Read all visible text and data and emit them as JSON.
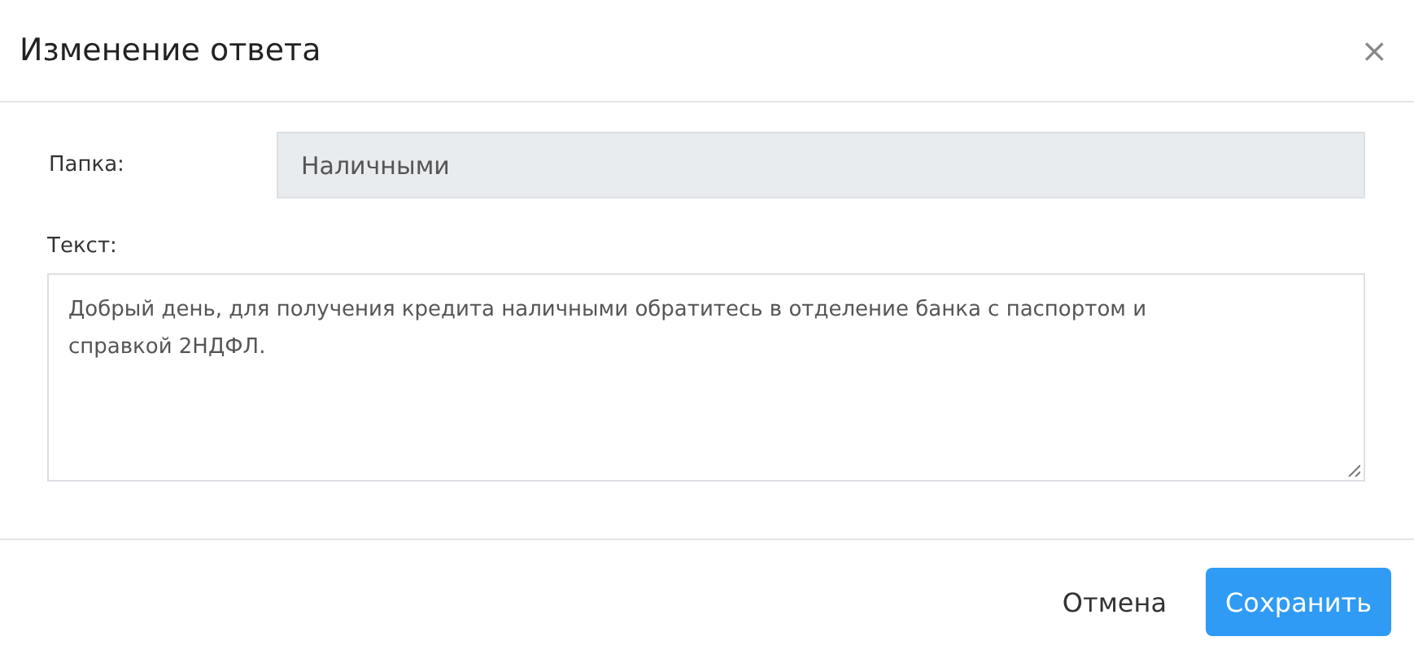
{
  "dialog": {
    "title": "Изменение ответа",
    "close": "×"
  },
  "fields": [
    {
      "kind": "input",
      "label": "Папка:",
      "value": "Наличными",
      "disabled": true
    },
    {
      "kind": "textarea",
      "label": "Текст:",
      "value": "Добрый день, для получения кредита наличными обратитесь в отделение банка с паспортом и справкой 2НДФЛ.",
      "disabled": false
    }
  ],
  "buttons": [
    {
      "label": "Отмена",
      "kind": "secondary"
    },
    {
      "label": "Сохранить",
      "kind": "primary"
    }
  ]
}
